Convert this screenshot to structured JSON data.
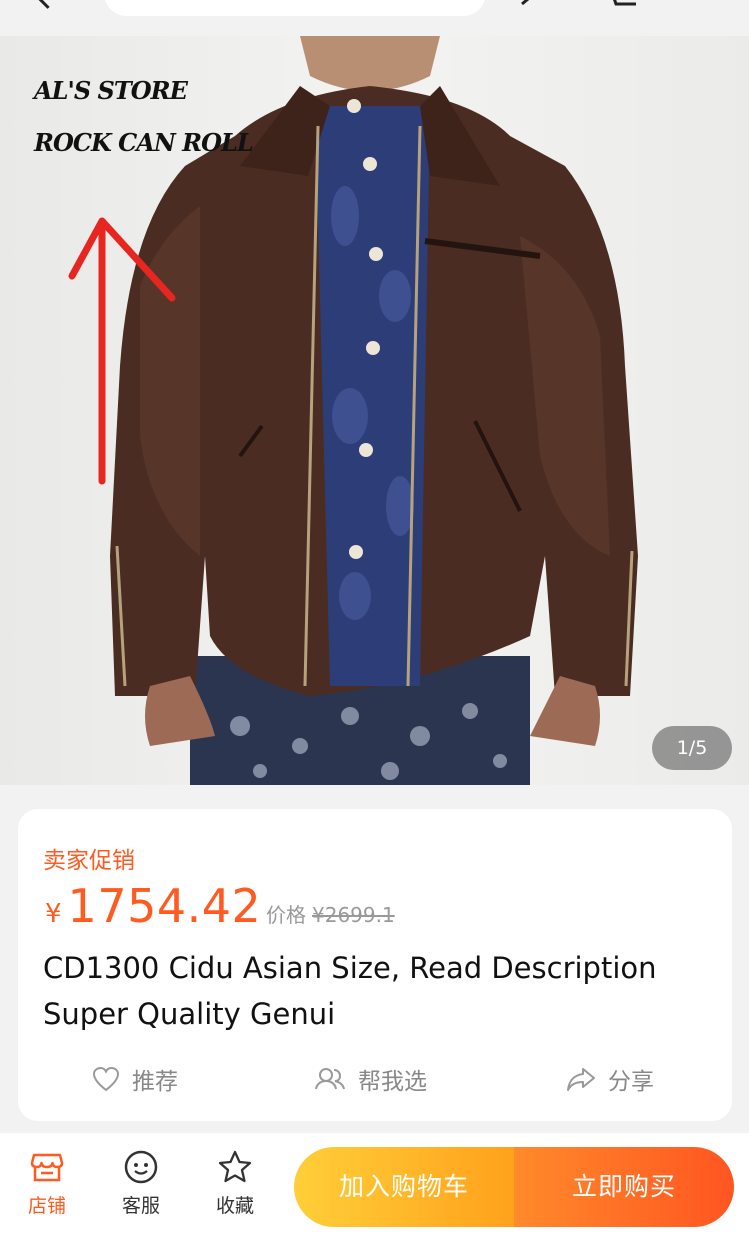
{
  "topbar": {
    "icons": [
      "back-icon",
      "share-icon",
      "cart-icon"
    ]
  },
  "hero": {
    "store_line1": "AL'S STORE",
    "store_line2": "ROCK CAN ROLL",
    "pager": "1/5"
  },
  "product": {
    "promo_label": "卖家促销",
    "currency": "¥",
    "price": "1754.42",
    "orig_label": "价格",
    "orig_price": "¥2699.1",
    "title": "CD1300 Cidu Asian Size, Read Description Super Quality Genui"
  },
  "actions": {
    "recommend": "推荐",
    "help_choose": "帮我选",
    "share": "分享"
  },
  "bottombar": {
    "store": "店铺",
    "service": "客服",
    "favorite": "收藏",
    "add_to_cart": "加入购物车",
    "buy_now": "立即购买"
  },
  "colors": {
    "accent": "#ff5a1f",
    "cart_button": "#ffb82a",
    "buy_button": "#ff6a25",
    "jacket": "#4b2c22"
  }
}
